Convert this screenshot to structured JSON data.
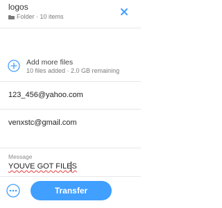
{
  "header": {
    "title": "logos",
    "meta": "Folder · 10 items"
  },
  "add_files": {
    "label": "Add more files",
    "sub": "10 files added · 2.0 GB remaining"
  },
  "recipient": {
    "value": "123_456@yahoo.com"
  },
  "sender": {
    "value": "venxstc@gmail.com"
  },
  "message": {
    "label": "Message",
    "value": "YOUVE GOT FILES"
  },
  "footer": {
    "transfer_label": "Transfer"
  },
  "colors": {
    "accent": "#409fff",
    "divider": "#e6e7ea",
    "spellcheck": "#e23a3a"
  }
}
